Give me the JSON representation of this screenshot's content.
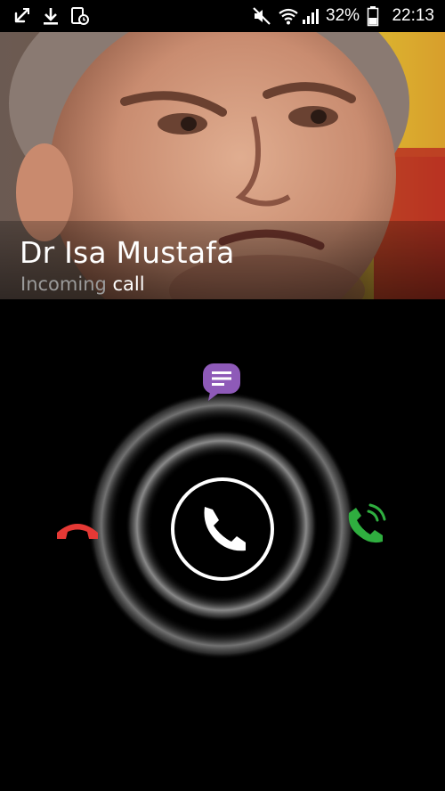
{
  "status_bar": {
    "left_icons": [
      "missed-call-icon",
      "download-icon",
      "call-log-icon"
    ],
    "right_icons": [
      "mute-icon",
      "wifi-icon",
      "signal-icon",
      "battery-icon"
    ],
    "battery_percent": "32%",
    "time": "22:13"
  },
  "caller": {
    "name": "Dr Isa Mustafa",
    "status_prefix": "Incoming",
    "status_suffix": "call",
    "photo_icon": "caller-photo"
  },
  "controls": {
    "message_icon": "message-bubble-icon",
    "decline_icon": "decline-call-icon",
    "accept_icon": "accept-call-icon",
    "answer_icon": "phone-handset-icon"
  },
  "colors": {
    "message": "#8e5ab8",
    "decline": "#e53935",
    "accept": "#2fae3f",
    "handle": "#ffffff"
  }
}
